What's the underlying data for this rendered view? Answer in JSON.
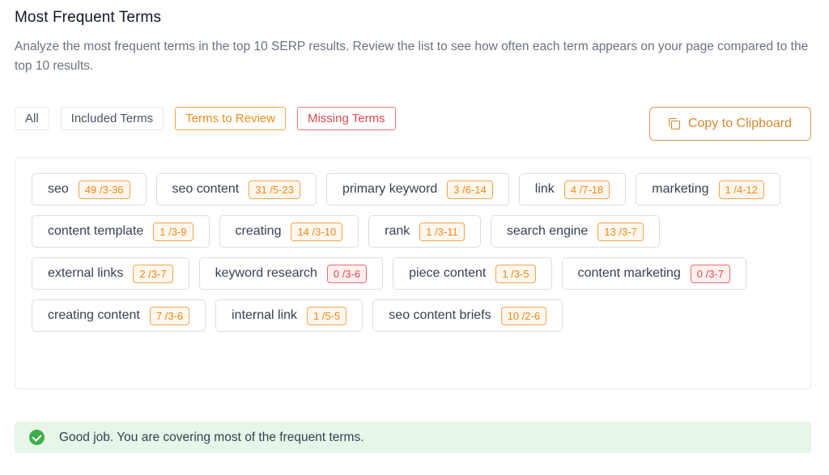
{
  "header": {
    "title": "Most Frequent Terms",
    "description": "Analyze the most frequent terms in the top 10 SERP results. Review the list to see how often each term appears on your page compared to the top 10 results."
  },
  "filters": [
    {
      "label": "All",
      "variant": "default"
    },
    {
      "label": "Included Terms",
      "variant": "default"
    },
    {
      "label": "Terms to Review",
      "variant": "review"
    },
    {
      "label": "Missing Terms",
      "variant": "missing"
    }
  ],
  "copy_button": {
    "label": "Copy to Clipboard",
    "icon": "copy-icon"
  },
  "terms": [
    {
      "term": "seo",
      "count": "49 /3-36",
      "status": "review"
    },
    {
      "term": "seo content",
      "count": "31 /5-23",
      "status": "review"
    },
    {
      "term": "primary keyword",
      "count": "3 /6-14",
      "status": "review"
    },
    {
      "term": "link",
      "count": "4 /7-18",
      "status": "review"
    },
    {
      "term": "marketing",
      "count": "1 /4-12",
      "status": "review"
    },
    {
      "term": "content template",
      "count": "1 /3-9",
      "status": "review"
    },
    {
      "term": "creating",
      "count": "14 /3-10",
      "status": "review"
    },
    {
      "term": "rank",
      "count": "1 /3-11",
      "status": "review"
    },
    {
      "term": "search engine",
      "count": "13 /3-7",
      "status": "review"
    },
    {
      "term": "external links",
      "count": "2 /3-7",
      "status": "review"
    },
    {
      "term": "keyword research",
      "count": "0 /3-6",
      "status": "missing"
    },
    {
      "term": "piece content",
      "count": "1 /3-5",
      "status": "review"
    },
    {
      "term": "content marketing",
      "count": "0 /3-7",
      "status": "missing"
    },
    {
      "term": "creating content",
      "count": "7 /3-6",
      "status": "review"
    },
    {
      "term": "internal link",
      "count": "1 /5-5",
      "status": "review"
    },
    {
      "term": "seo content briefs",
      "count": "10 /2-6",
      "status": "review"
    }
  ],
  "status_message": {
    "icon": "check-circle-icon",
    "text": "Good job. You are covering most of the frequent terms.",
    "color": "#3cb04a"
  },
  "colors": {
    "review": "#ef8a17",
    "missing": "#e5484d",
    "accent": "#d4882e",
    "success_bg": "#e8f5e9"
  }
}
